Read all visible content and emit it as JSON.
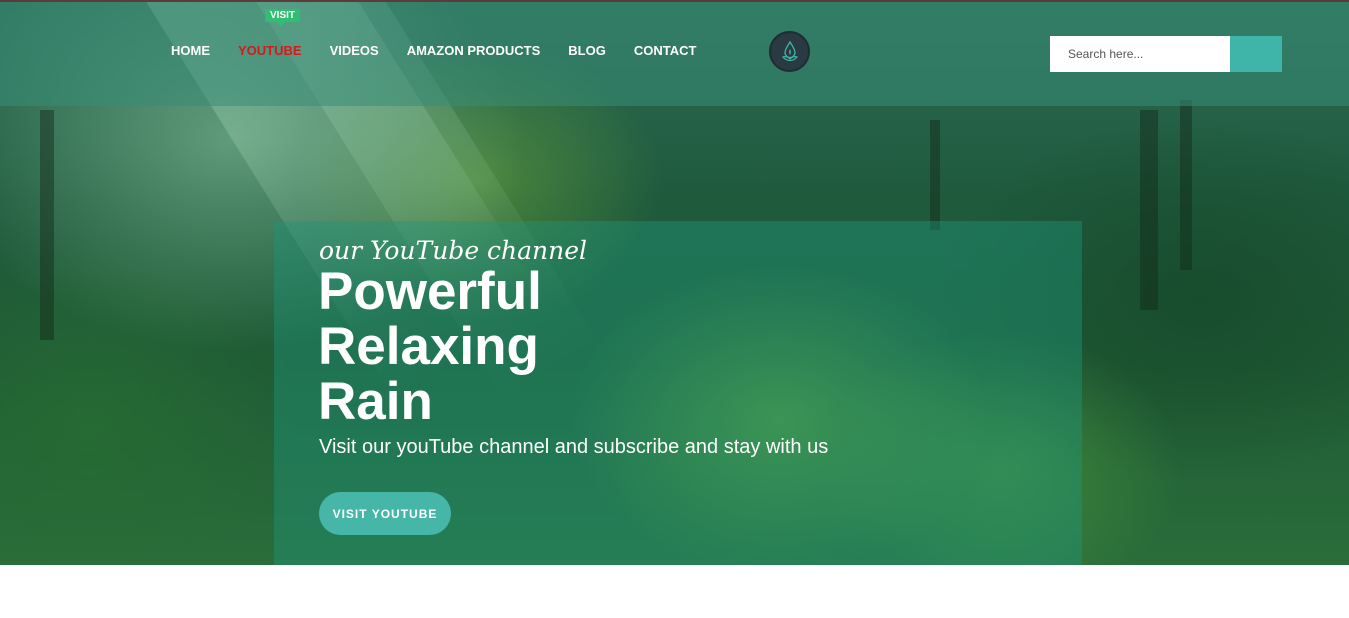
{
  "colors": {
    "nav_active": "#d61a1a",
    "badge": "#2fbf71",
    "accent_teal": "#45b6a7",
    "search_button": "#3fb4a9",
    "logo_bg": "#2a3a42"
  },
  "header": {
    "badge_label": "VISIT",
    "nav_items": [
      {
        "label": "HOME"
      },
      {
        "label": "YOUTUBE",
        "active": true
      },
      {
        "label": "VIDEOS"
      },
      {
        "label": "AMAZON PRODUCTS"
      },
      {
        "label": "BLOG"
      },
      {
        "label": "CONTACT"
      }
    ],
    "logo_icon": "lotus-drop-icon",
    "search": {
      "placeholder": "Search here...",
      "value": ""
    }
  },
  "hero": {
    "eyebrow": "our YouTube channel",
    "headline_lines": [
      "Powerful",
      "Relaxing",
      "Rain"
    ],
    "subtext": "Visit our youTube channel and subscribe and stay with us",
    "cta_label": "VISIT YOUTUBE",
    "background_icon": "forest-image"
  }
}
